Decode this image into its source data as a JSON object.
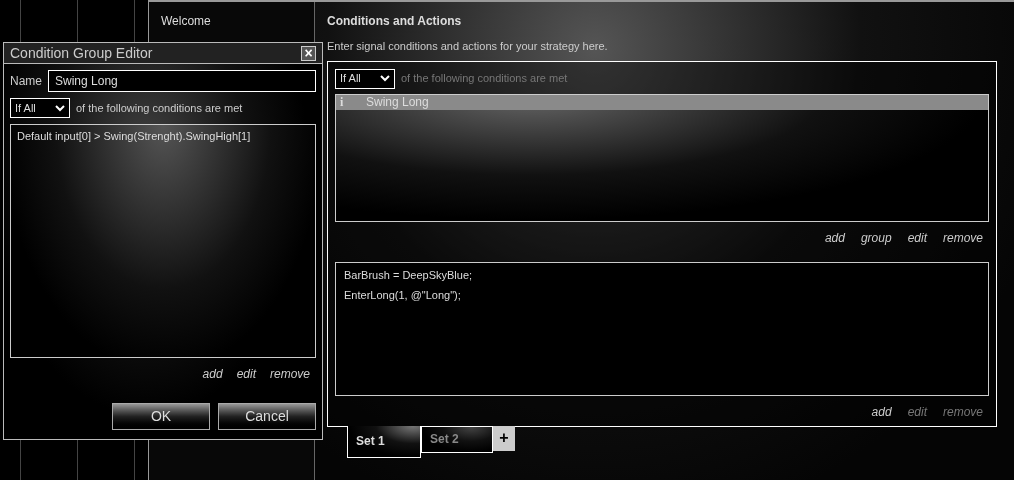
{
  "sidebar": {
    "items": [
      {
        "label": "Welcome"
      }
    ]
  },
  "panel": {
    "title": "Conditions and Actions",
    "subtitle": "Enter signal conditions and actions for your strategy here.",
    "condition_mode": "If All",
    "condition_text": "of the following conditions are met",
    "conditions": [
      {
        "icon": "i",
        "label": "Swing Long",
        "selected": true
      }
    ],
    "condition_links": [
      {
        "label": "add",
        "disabled": false
      },
      {
        "label": "group",
        "disabled": false
      },
      {
        "label": "edit",
        "disabled": false
      },
      {
        "label": "remove",
        "disabled": false
      }
    ],
    "actions": [
      "BarBrush = DeepSkyBlue;",
      "EnterLong(1, @\"Long\");"
    ],
    "action_links": [
      {
        "label": "add",
        "disabled": false
      },
      {
        "label": "edit",
        "disabled": true
      },
      {
        "label": "remove",
        "disabled": true
      }
    ],
    "sets": [
      {
        "label": "Set 1",
        "selected": true
      },
      {
        "label": "Set 2",
        "selected": false
      }
    ],
    "add_set": "+"
  },
  "dialog": {
    "title": "Condition Group Editor",
    "close": "×",
    "name_label": "Name",
    "name_value": "Swing Long",
    "condition_mode": "If All",
    "condition_text": "of the following conditions are met",
    "conditions": [
      "Default input[0] > Swing(Strenght).SwingHigh[1]"
    ],
    "links": [
      {
        "label": "add",
        "disabled": false
      },
      {
        "label": "edit",
        "disabled": false
      },
      {
        "label": "remove",
        "disabled": false
      }
    ],
    "buttons": [
      "OK",
      "Cancel"
    ]
  }
}
